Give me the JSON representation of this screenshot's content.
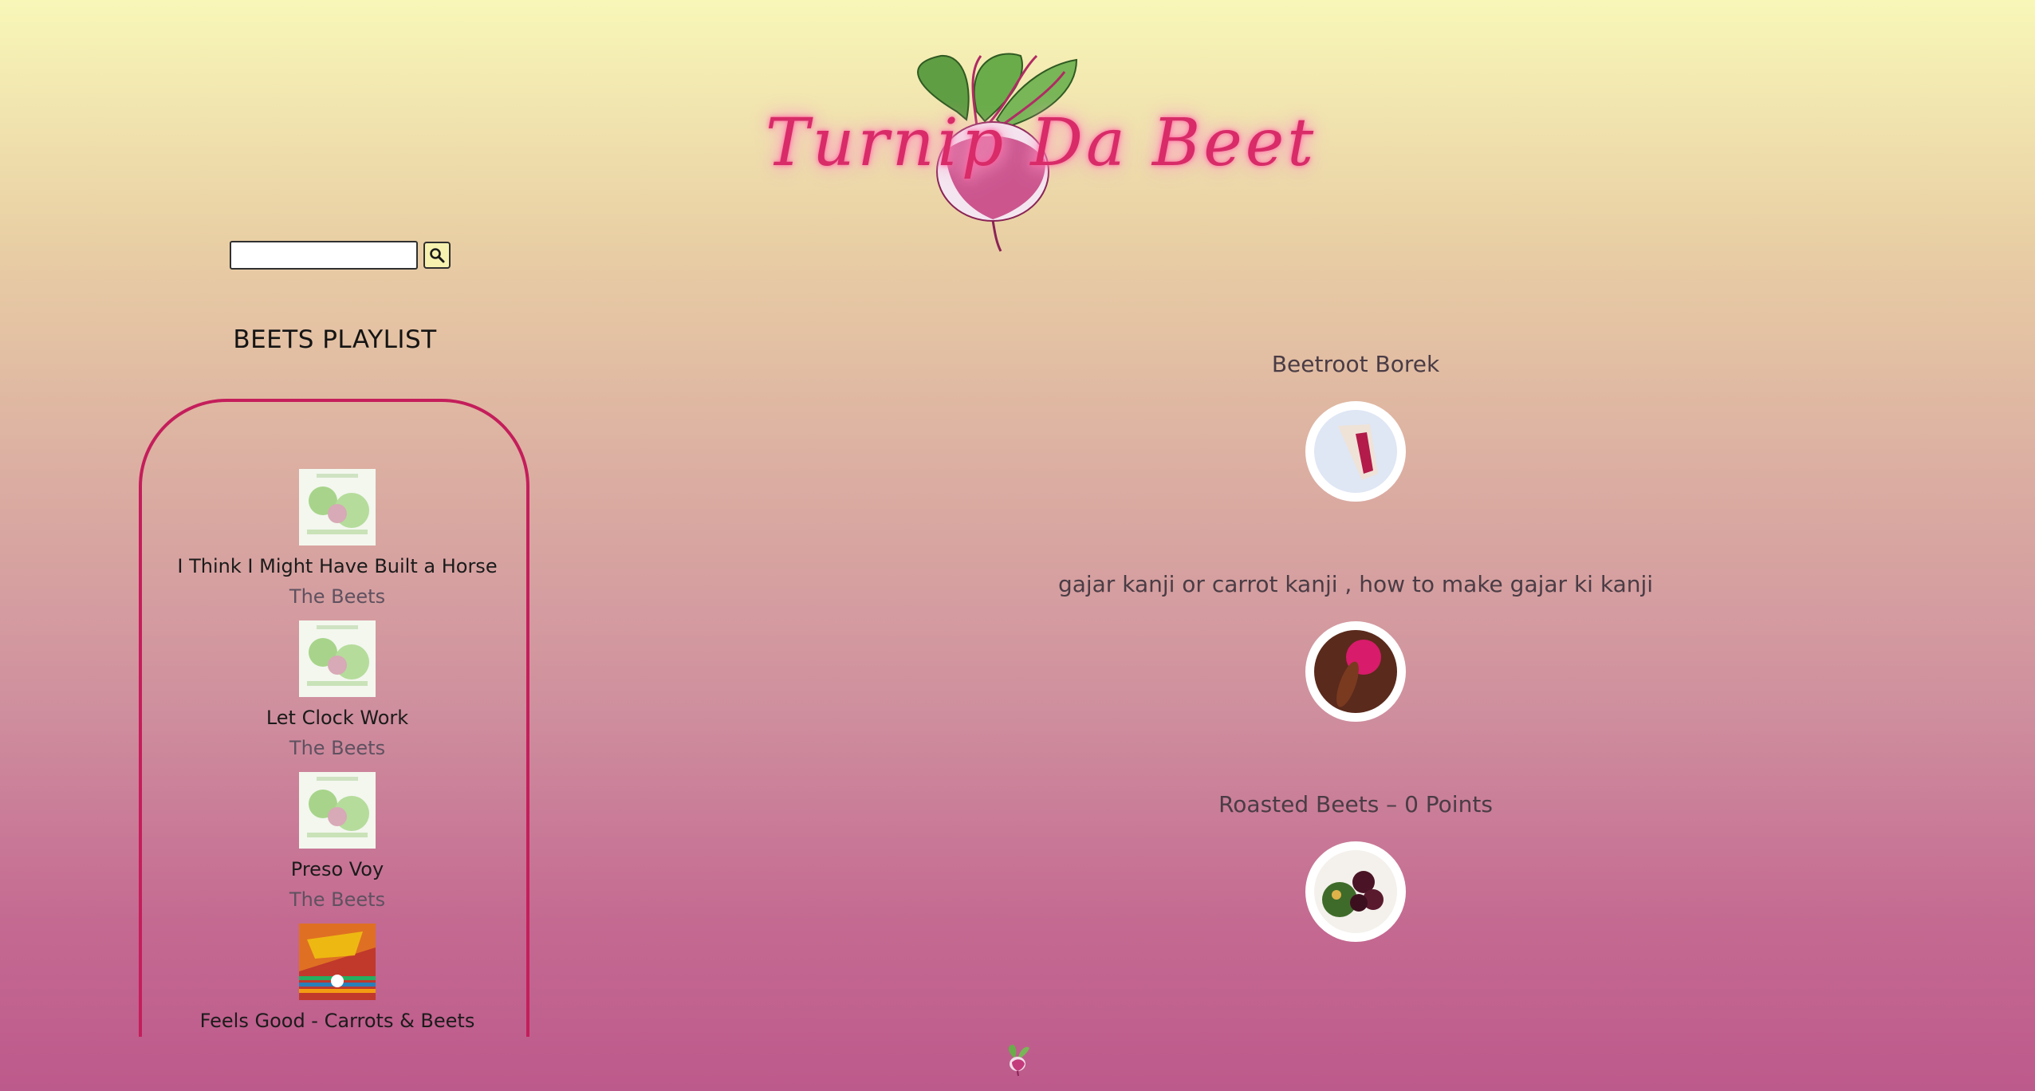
{
  "header": {
    "logo_text": "Turnip Da Beet",
    "logo_icon": "beet-illustration-icon"
  },
  "search": {
    "value": "",
    "placeholder": "",
    "button_icon": "search-icon"
  },
  "playlist": {
    "title": "BEETS PLAYLIST",
    "tracks": [
      {
        "title": "I Think I Might Have Built a Horse",
        "artist": "The Beets",
        "cover": "album-cover-illustration"
      },
      {
        "title": "Let Clock Work",
        "artist": "The Beets",
        "cover": "album-cover-illustration"
      },
      {
        "title": "Preso Voy",
        "artist": "The Beets",
        "cover": "album-cover-illustration"
      },
      {
        "title": "Feels Good - Carrots & Beets",
        "artist": "",
        "cover": "album-cover-red-compilation"
      }
    ]
  },
  "recipes": [
    {
      "title": "Beetroot Borek",
      "thumb": "borek-slice-photo"
    },
    {
      "title": "gajar kanji or carrot kanji , how to make gajar ki kanji",
      "thumb": "carrot-kanji-photo"
    },
    {
      "title": "Roasted Beets – 0 Points",
      "thumb": "roasted-beets-plate-photo"
    }
  ],
  "footer": {
    "icon": "small-beet-icon"
  },
  "colors": {
    "accent": "#c41e5b",
    "logo_glow": "#ff5fa0",
    "background_top": "#f8f7b8",
    "background_bottom": "#bd5a8c"
  }
}
